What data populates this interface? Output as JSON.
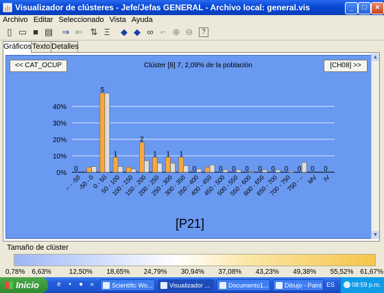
{
  "window": {
    "title": "Visualizador de clústeres - Jefe/Jefas GENERAL - Archivo local: general.vis",
    "buttons": {
      "minimize": "_",
      "maximize": "□",
      "close": "×"
    }
  },
  "menu": [
    "Archivo",
    "Editar",
    "Seleccionado",
    "Vista",
    "Ayuda"
  ],
  "toolbar": [
    "new-icon",
    "open-icon",
    "save-icon",
    "print-icon",
    "sep",
    "redo-icon",
    "undo-icon",
    "sort-asc-icon",
    "sort-desc-icon",
    "sep",
    "back-icon",
    "forward-icon",
    "find-icon",
    "select-icon",
    "zoom-in-icon",
    "zoom-out-icon",
    "sep",
    "help-icon"
  ],
  "tabs": [
    "Gráficos",
    "Texto",
    "Detalles"
  ],
  "nav": {
    "prev": "<< CAT_OCUP",
    "next": "[CH08] >>"
  },
  "chart_header": "Clúster [8] 7, 2,09% de la población",
  "chart_data": {
    "type": "bar",
    "title": "[P21]",
    "ylim": [
      0,
      50
    ],
    "yticks": [
      "0%",
      "10%",
      "20%",
      "30%",
      "40%"
    ],
    "categories": [
      "-- - -50",
      "-50 - 0",
      "0 - 50",
      "50 - 100",
      "100 - 150",
      "150 - 200",
      "200 - 250",
      "250 - 300",
      "300 - 350",
      "350 - 400",
      "400 - 450",
      "450 - 500",
      "500 - 550",
      "550 - 600",
      "600 - 650",
      "650 - 700",
      "700 - 750",
      "750 - --",
      "MV",
      "IV"
    ],
    "series": [
      {
        "values": [
          0,
          3,
          48,
          9,
          3,
          18,
          9,
          9,
          9,
          0,
          3,
          0,
          0,
          0,
          0,
          0,
          0,
          0,
          0,
          0
        ],
        "color": "#f7a83f"
      },
      {
        "values": [
          0,
          3.5,
          48,
          3.5,
          2,
          7,
          5.5,
          5.5,
          4,
          2,
          4.5,
          1.5,
          1.5,
          0.5,
          1.5,
          1.5,
          0.8,
          6,
          0,
          0
        ],
        "color": "#dcdcdc"
      }
    ],
    "data_labels": [
      "0",
      "",
      "5",
      "1",
      "",
      "2",
      "1",
      "1",
      "1",
      "0",
      "",
      "0",
      "0",
      "0",
      "0",
      "0",
      "0",
      "0",
      "0",
      "0"
    ]
  },
  "cluster_size": {
    "label": "Tamaño de clúster",
    "ticks": [
      "0,78%",
      "6,63%",
      "12,50%",
      "18,65%",
      "24,79%",
      "30,94%",
      "37,08%",
      "43,23%",
      "49,38%",
      "55,52%",
      "61,67%"
    ]
  },
  "taskbar": {
    "start": "Inicio",
    "tasks": [
      "Scientific Wo...",
      "Visualizador ...",
      "Documento1...",
      "Dibujo - Paint"
    ],
    "lang": "ES",
    "clock": "08:59 p.m."
  }
}
